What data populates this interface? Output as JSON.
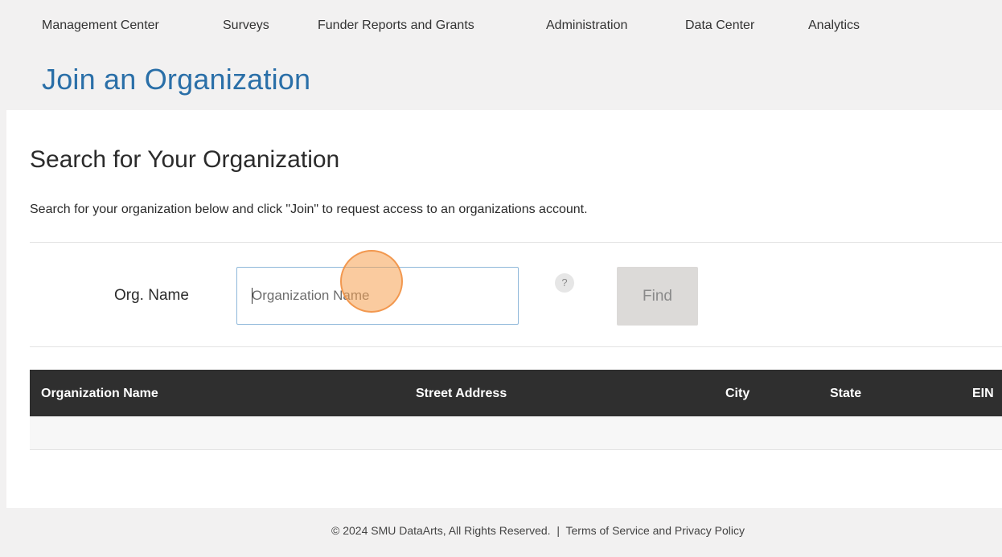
{
  "nav": {
    "items": [
      {
        "label": "Management Center"
      },
      {
        "label": "Surveys"
      },
      {
        "label": "Funder Reports and Grants"
      },
      {
        "label": "Administration"
      },
      {
        "label": "Data Center"
      },
      {
        "label": "Analytics"
      }
    ]
  },
  "page": {
    "title": "Join an Organization"
  },
  "search": {
    "section_title": "Search for Your Organization",
    "instructions": "Search for your organization below and click \"Join\" to request access to an organizations account.",
    "label": "Org. Name",
    "placeholder": "Organization Name",
    "value": "",
    "help_icon": "question-icon",
    "help_symbol": "?",
    "find_label": "Find"
  },
  "table": {
    "columns": [
      "Organization Name",
      "Street Address",
      "City",
      "State",
      "EIN"
    ],
    "rows": []
  },
  "footer": {
    "copyright": "© 2024 SMU DataArts, All Rights Reserved.",
    "separator": "|",
    "link_label": "Terms of Service and Privacy Policy"
  },
  "colors": {
    "accent": "#2a6fa8",
    "table_header": "#2f2f2f",
    "click_marker": "#f5a050"
  }
}
